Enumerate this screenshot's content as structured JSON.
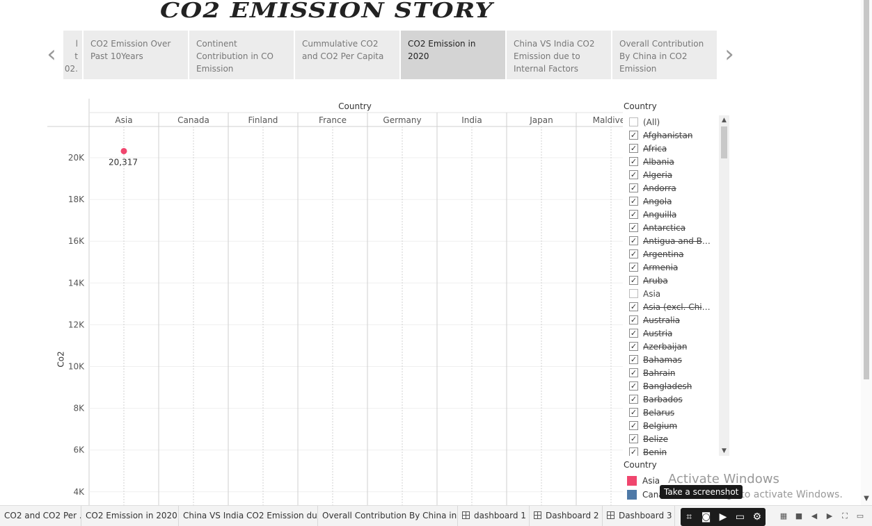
{
  "story": {
    "title": "CO2 EMISSION STORY",
    "prev_icon": "chevron-left-icon",
    "next_icon": "chevron-right-icon",
    "points": [
      {
        "label": "l\nt\n02.",
        "active": false
      },
      {
        "label": "CO2 Emission Over Past 10Years",
        "active": false
      },
      {
        "label": "Continent Contribution in CO Emission",
        "active": false
      },
      {
        "label": "Cummulative CO2 and CO2 Per Capita",
        "active": false
      },
      {
        "label": "CO2 Emission in 2020",
        "active": true
      },
      {
        "label": "China VS India CO2 Emission due to Internal Factors",
        "active": false
      },
      {
        "label": "Overall Contribution By China in CO2 Emission",
        "active": false
      }
    ]
  },
  "chart_data": {
    "type": "scatter",
    "column_header": "Country",
    "categories": [
      "Asia",
      "Canada",
      "Finland",
      "France",
      "Germany",
      "India",
      "Japan",
      "Maldives"
    ],
    "ylabel": "Co2",
    "yticks": [
      "20K",
      "18K",
      "16K",
      "14K",
      "12K",
      "10K",
      "8K",
      "6K",
      "4K"
    ],
    "ytick_values": [
      20000,
      18000,
      16000,
      14000,
      12000,
      10000,
      8000,
      6000,
      4000
    ],
    "points": [
      {
        "category": "Asia",
        "value": 20317,
        "label": "20,317",
        "color": "#f0466e"
      }
    ]
  },
  "filter": {
    "title": "Country",
    "items": [
      {
        "label": "(All)",
        "checked": false,
        "strike": false
      },
      {
        "label": "Afghanistan",
        "checked": true,
        "strike": true
      },
      {
        "label": "Africa",
        "checked": true,
        "strike": true
      },
      {
        "label": "Albania",
        "checked": true,
        "strike": true
      },
      {
        "label": "Algeria",
        "checked": true,
        "strike": true
      },
      {
        "label": "Andorra",
        "checked": true,
        "strike": true
      },
      {
        "label": "Angola",
        "checked": true,
        "strike": true
      },
      {
        "label": "Anguilla",
        "checked": true,
        "strike": true
      },
      {
        "label": "Antarctica",
        "checked": true,
        "strike": true
      },
      {
        "label": "Antigua and Bar...",
        "checked": true,
        "strike": true
      },
      {
        "label": "Argentina",
        "checked": true,
        "strike": true
      },
      {
        "label": "Armenia",
        "checked": true,
        "strike": true
      },
      {
        "label": "Aruba",
        "checked": true,
        "strike": true
      },
      {
        "label": "Asia",
        "checked": false,
        "strike": false
      },
      {
        "label": "Asia (excl. China ...",
        "checked": true,
        "strike": true
      },
      {
        "label": "Australia",
        "checked": true,
        "strike": true
      },
      {
        "label": "Austria",
        "checked": true,
        "strike": true
      },
      {
        "label": "Azerbaijan",
        "checked": true,
        "strike": true
      },
      {
        "label": "Bahamas",
        "checked": true,
        "strike": true
      },
      {
        "label": "Bahrain",
        "checked": true,
        "strike": true
      },
      {
        "label": "Bangladesh",
        "checked": true,
        "strike": true
      },
      {
        "label": "Barbados",
        "checked": true,
        "strike": true
      },
      {
        "label": "Belarus",
        "checked": true,
        "strike": true
      },
      {
        "label": "Belgium",
        "checked": true,
        "strike": true
      },
      {
        "label": "Belize",
        "checked": true,
        "strike": true
      },
      {
        "label": "Benin",
        "checked": true,
        "strike": true
      }
    ],
    "check_glyph": "✓",
    "scroll_up": "▲",
    "scroll_down": "▼"
  },
  "legend": {
    "title": "Country",
    "items": [
      {
        "label": "Asia",
        "color": "#f0466e"
      },
      {
        "label": "Cana",
        "color": "#4e79a7"
      }
    ]
  },
  "watermark": {
    "line1": "Activate Windows",
    "line2": "Go to Settings to activate Windows."
  },
  "tooltip": "Take a screenshot",
  "bottom_tabs": [
    {
      "label": "CO2 and CO2 Per ...",
      "icon": ""
    },
    {
      "label": "CO2 Emission in 2020",
      "icon": ""
    },
    {
      "label": "China VS India CO2 Emission du...",
      "icon": ""
    },
    {
      "label": "Overall Contribution By China in ...",
      "icon": ""
    },
    {
      "label": "dashboard 1",
      "icon": "dashboard-grid-icon"
    },
    {
      "label": "Dashboard 2",
      "icon": "dashboard-grid-icon"
    },
    {
      "label": "Dashboard 3",
      "icon": "dashboard-grid-icon"
    }
  ],
  "snip_tools": [
    "screen-snip-icon",
    "camera-icon",
    "video-icon",
    "window-icon",
    "gear-icon"
  ],
  "view_controls": [
    "show-sheets-icon",
    "filmstrip-icon",
    "previous-sheet-icon",
    "next-sheet-icon",
    "fullscreen-icon",
    "presentation-icon"
  ]
}
